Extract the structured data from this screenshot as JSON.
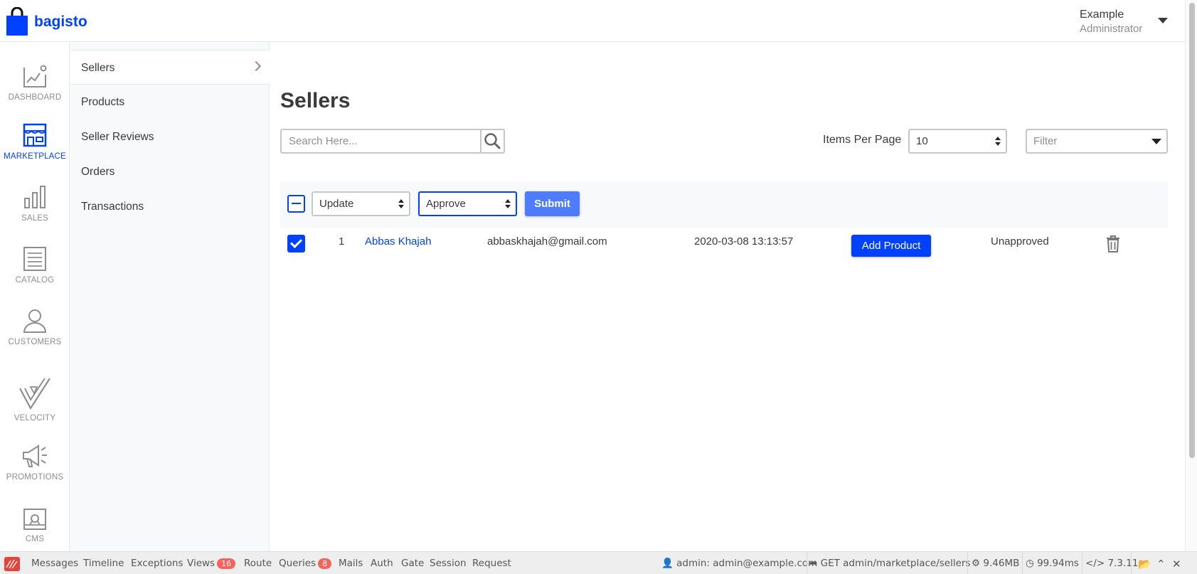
{
  "header": {
    "brand": "bagisto",
    "user_name": "Example",
    "user_role": "Administrator"
  },
  "nav": {
    "items": [
      {
        "label": "DASHBOARD",
        "icon": "dashboard-chart-icon"
      },
      {
        "label": "MARKETPLACE",
        "icon": "storefront-icon",
        "active": true
      },
      {
        "label": "SALES",
        "icon": "bar-chart-icon"
      },
      {
        "label": "CATALOG",
        "icon": "list-document-icon"
      },
      {
        "label": "CUSTOMERS",
        "icon": "user-icon"
      },
      {
        "label": "VELOCITY",
        "icon": "velocity-check-icon"
      },
      {
        "label": "PROMOTIONS",
        "icon": "megaphone-icon"
      },
      {
        "label": "CMS",
        "icon": "cms-image-icon"
      }
    ]
  },
  "subnav": {
    "items": [
      {
        "label": "Sellers",
        "active": true
      },
      {
        "label": "Products"
      },
      {
        "label": "Seller Reviews"
      },
      {
        "label": "Orders"
      },
      {
        "label": "Transactions"
      }
    ]
  },
  "main": {
    "title": "Sellers",
    "search_placeholder": "Search Here...",
    "items_per_page_label": "Items Per Page",
    "items_per_page_value": "10",
    "filter_placeholder": "Filter",
    "mass_action": {
      "action_value": "Update",
      "status_value": "Approve",
      "submit_label": "Submit"
    },
    "rows": [
      {
        "id": "1",
        "name": "Abbas Khajah",
        "email": "abbaskhajah@gmail.com",
        "created_at": "2020-03-08 13:13:57",
        "add_product_label": "Add Product",
        "status": "Unapproved"
      }
    ]
  },
  "debugbar": {
    "tabs": [
      "Messages",
      "Timeline",
      "Exceptions",
      "Views",
      "Route",
      "Queries",
      "Mails",
      "Auth",
      "Gate",
      "Session",
      "Request"
    ],
    "views_count": "16",
    "queries_count": "8",
    "user": "admin: admin@example.com",
    "route": "GET admin/marketplace/sellers",
    "memory": "9.46MB",
    "time": "99.94ms",
    "php_version": "7.3.11"
  },
  "colors": {
    "brand": "#0041ff",
    "submit": "#4d7cfe",
    "badge": "#f4645f"
  }
}
